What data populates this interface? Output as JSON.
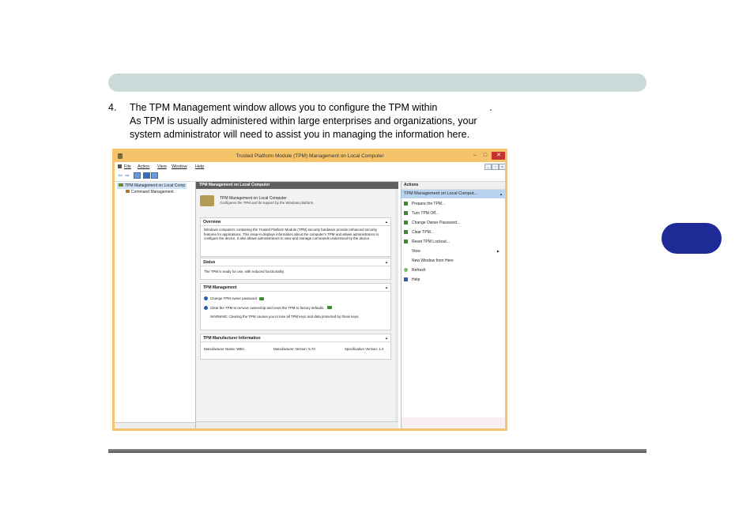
{
  "document": {
    "step_number": "4.",
    "lines": [
      "The TPM Management window allows you to configure the TPM within",
      "As TPM is usually administered within large enterprises and organizations, your",
      "system administrator will need to assist you in managing the information here."
    ],
    "line1_end": "."
  },
  "window": {
    "title": "Trusted Platform Module (TPM) Management on Local Computer",
    "controls": {
      "min": "–",
      "max": "□",
      "close": "✕"
    },
    "menu": [
      "File",
      "Action",
      "View",
      "Window",
      "Help"
    ],
    "tree": {
      "root": "TPM Management on Local Comp",
      "child": "Command Management"
    },
    "center": {
      "header": "TPM Management on Local Computer",
      "intro_title": "TPM Management on Local Computer",
      "intro_sub": "Configures the TPM and its support by the Windows platform",
      "overview": {
        "heading": "Overview",
        "text": "Windows computers containing the Trusted Platform Module (TPM) security hardware provide enhanced security features for applications. This snap-in displays information about the computer's TPM and allows administrators to configure the device. It also allows administrators to view and manage commands understood by the device."
      },
      "status": {
        "heading": "Status",
        "text": "The TPM is ready for use, with reduced functionality."
      },
      "tpm_management": {
        "heading": "TPM Management",
        "item1": "Change TPM owner password",
        "item2": "Clear the TPM to remove ownership and reset the TPM to factory defaults.",
        "warning": "WARNING: Clearing the TPM causes you to lose all TPM keys and data protected by those keys."
      },
      "manufacturer": {
        "heading": "TPM Manufacturer Information",
        "name_label": "Manufacturer Name:",
        "name_value": "WBC",
        "version_label": "Manufacturer Version:",
        "version_value": "5.73",
        "spec_label": "Specification Version:",
        "spec_value": "1.2"
      }
    },
    "actions": {
      "header": "Actions",
      "subheader": "TPM Management on Local Comput...",
      "items": [
        "Prepare the TPM...",
        "Turn TPM Off...",
        "Change Owner Password...",
        "Clear TPM...",
        "Reset TPM Lockout...",
        "View",
        "New Window from Here",
        "Refresh",
        "Help"
      ]
    }
  }
}
